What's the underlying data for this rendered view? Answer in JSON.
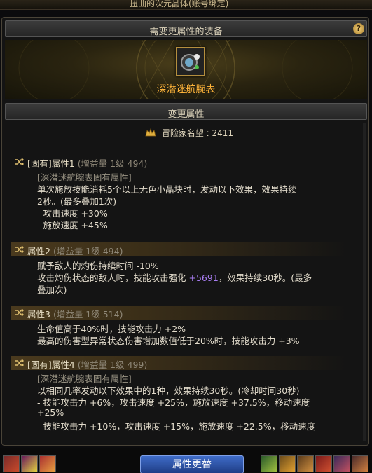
{
  "window": {
    "title": "扭曲的次元晶体(账号绑定)"
  },
  "equip_section": {
    "title": "需变更属性的装备",
    "help_label": "?",
    "item_name": "深潜迷航腕表",
    "item_icon": "watch-icon"
  },
  "attr_section": {
    "title": "变更属性",
    "fame_label": "冒险家名望 : 2411",
    "attributes": [
      {
        "header": "[固有]属性1",
        "gain": "(增益量 1级 494)",
        "lines": [
          "[深潜迷航腕表固有属性]",
          "单次施放技能消耗5个以上无色小晶块时，发动以下效果，效果持续",
          "2秒。(最多叠加1次)",
          "- 攻击速度 +30%",
          "- 施放速度 +45%"
        ]
      },
      {
        "header": "属性2",
        "gain": "(增益量 1级 494)",
        "lines": [
          "赋予敌人的灼伤持续时间 -10%",
          "攻击灼伤状态的敌人时，技能攻击强化",
          "叠加次)"
        ],
        "buff_value": "+5691",
        "line2_tail": "，效果持续30秒。(最多"
      },
      {
        "header": "属性3",
        "gain": "(增益量 1级 514)",
        "lines": [
          "生命值高于40%时，技能攻击力 +2%",
          "最高的伤害型异常状态伤害增加数值低于20%时，技能攻击力 +3%"
        ]
      },
      {
        "header": "[固有]属性4",
        "gain": "(增益量 1级 499)",
        "lines": [
          "[深潜迷航腕表固有属性]",
          "以相同几率发动以下效果中的1种，效果持续30秒。(冷却时间30秒)",
          "- 技能攻击力 +6%，攻击速度 +25%，施放速度 +37.5%，移动速度",
          "+25%",
          "- 技能攻击力 +10%，攻击速度 +15%，施放速度 +22.5%，移动速度"
        ]
      }
    ]
  },
  "footer": {
    "change_button": "属性更替"
  },
  "colors": {
    "item_name": "#ffb43a",
    "buff": "#a77cf0",
    "button": "#2f56b0"
  }
}
